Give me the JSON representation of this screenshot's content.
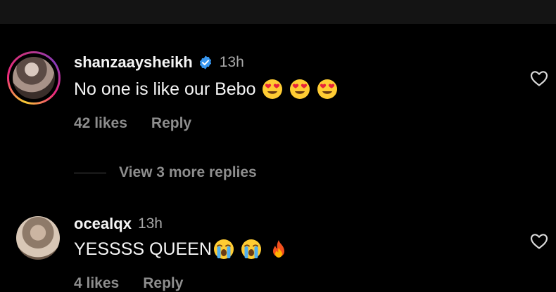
{
  "comments": [
    {
      "username": "shanzaaysheikh",
      "verified": true,
      "time": "13h",
      "text": "No one is like our Bebo",
      "emojis": [
        "heart-eyes",
        "heart-eyes",
        "heart-eyes"
      ],
      "likes": "42 likes",
      "reply": "Reply"
    },
    {
      "username": "ocealqx",
      "verified": false,
      "time": "13h",
      "text": "YESSSS QUEEN",
      "emojis": [
        "loudly-crying",
        "loudly-crying",
        "fire"
      ],
      "likes": "4 likes",
      "reply": "Reply"
    }
  ],
  "view_more_replies": "View 3 more replies",
  "colors": {
    "background": "#000000",
    "top_bar": "#141414",
    "primary_text": "#f5f5f5",
    "secondary_text": "#8e8e8e",
    "verified_badge": "#3897f0"
  }
}
